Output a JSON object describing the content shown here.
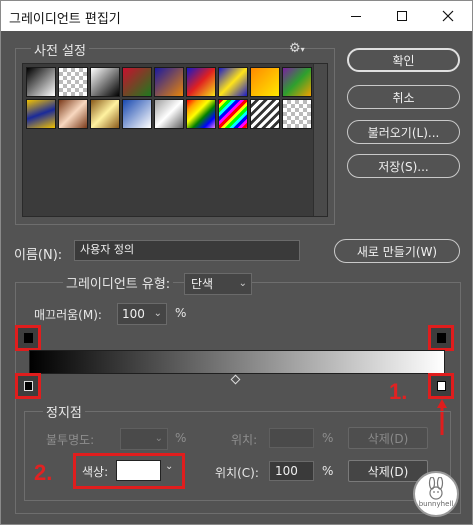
{
  "window": {
    "title": "그레이디언트 편집기"
  },
  "presets": {
    "title": "사전 설정",
    "settings_icon": "gear-icon"
  },
  "buttons": {
    "ok": "확인",
    "cancel": "취소",
    "load": "불러오기(L)...",
    "save": "저장(S)...",
    "new": "새로 만들기(W)"
  },
  "name": {
    "label": "이름(N):",
    "value": "사용자 정의"
  },
  "gradient_type": {
    "label": "그레이디언트 유형:",
    "value": "단색"
  },
  "smoothness": {
    "label": "매끄러움(M):",
    "value": "100",
    "unit": "%"
  },
  "stops": {
    "title": "정지점",
    "opacity_label": "불투명도:",
    "opacity_unit": "%",
    "location_label_top": "위치:",
    "location_unit_top": "%",
    "delete_top": "삭제(D)",
    "color_label": "색상:",
    "location_label": "위치(C):",
    "location_value": "100",
    "location_unit": "%",
    "delete": "삭제(D)",
    "color_value": "#ffffff"
  },
  "annotations": {
    "one": "1.",
    "two": "2."
  },
  "watermark": "bunnyhell",
  "colors": {
    "highlight": "#e01d1d",
    "panel": "#535353"
  }
}
